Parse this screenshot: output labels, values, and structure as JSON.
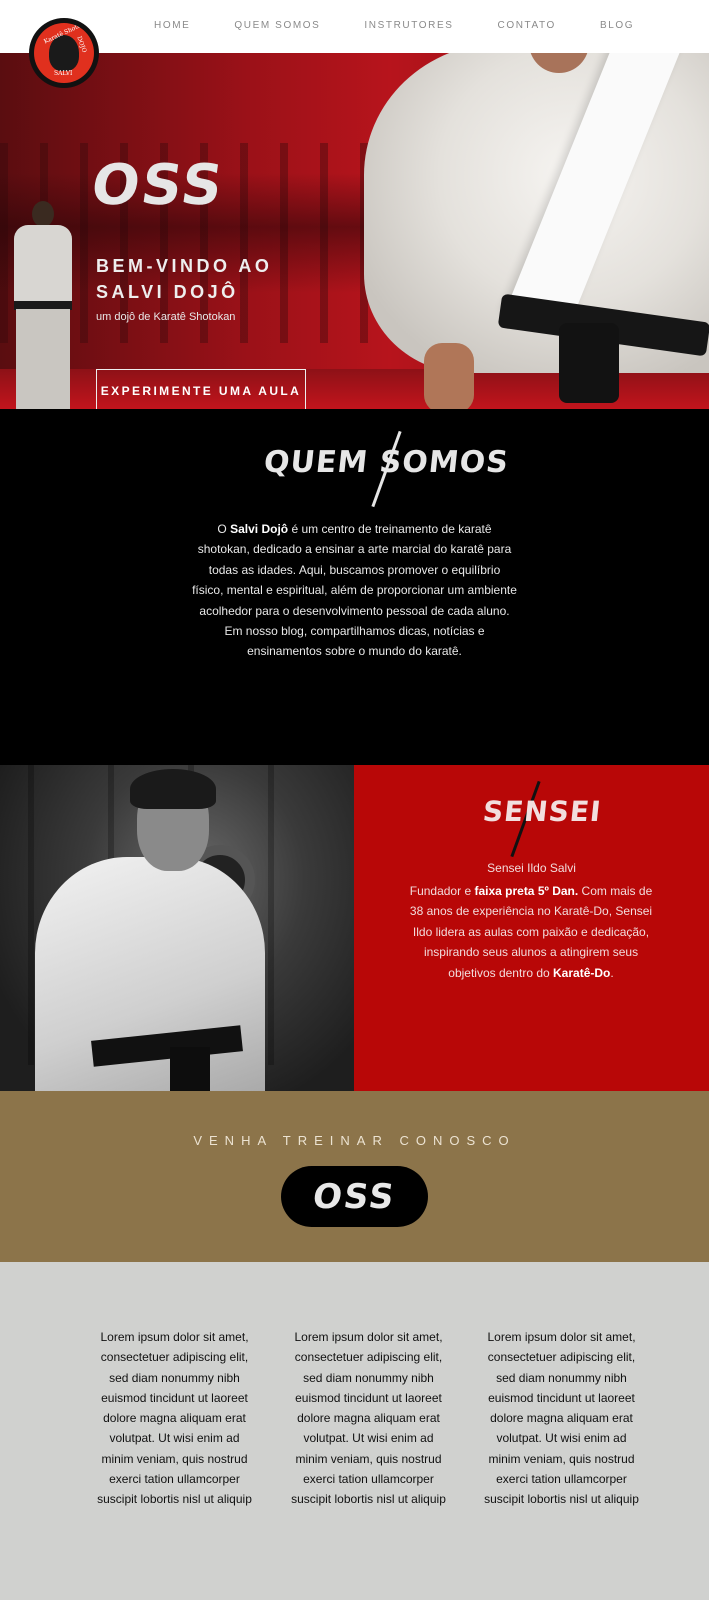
{
  "nav": {
    "logo": {
      "ring_text_top": "Karatê Shotokan",
      "ring_text_right": "DOJO",
      "ring_text_bottom": "SALVI"
    },
    "items": [
      {
        "label": "HOME"
      },
      {
        "label": "QUEM SOMOS"
      },
      {
        "label": "INSTRUTORES"
      },
      {
        "label": "CONTATO"
      },
      {
        "label": "BLOG"
      }
    ]
  },
  "hero": {
    "oss": "OSS",
    "title_line1": "BEM-VINDO AO",
    "title_line2": "SALVI DOJÔ",
    "subtitle": "um dojô de Karatê Shotokan",
    "cta_label": "EXPERIMENTE UMA AULA"
  },
  "about": {
    "heading": "QUEM SOMOS",
    "text_prefix": "O ",
    "text_bold": "Salvi Dojô",
    "text_rest": " é um centro de treinamento de karatê shotokan, dedicado a ensinar a arte marcial do karatê para todas as idades. Aqui, buscamos promover o equilíbrio físico, mental e espiritual, além de proporcionar um ambiente acolhedor para o desenvolvimento pessoal de cada aluno. Em nosso blog, compartilhamos dicas, notícias e ensinamentos sobre o mundo do karatê."
  },
  "sensei": {
    "heading": "SENSEI",
    "name": "Sensei Ildo Salvi",
    "text_a": "Fundador e ",
    "text_b": "faixa preta 5º Dan.",
    "text_c": " Com mais de 38 anos de experiência no Karatê-Do, Sensei Ildo lidera as aulas com paixão e dedicação, inspirando seus alunos a atingirem seus objetivos dentro do ",
    "text_d": "Karatê-Do",
    "text_e": "."
  },
  "join": {
    "text": "VENHA TREINAR CONOSCO",
    "button_label": "OSS"
  },
  "lorem": {
    "columns": [
      "Lorem ipsum dolor sit amet, consectetuer adipiscing elit, sed diam nonummy nibh euismod tincidunt ut laoreet dolore magna aliquam erat volutpat. Ut wisi enim ad minim veniam, quis nostrud exerci tation ullamcorper suscipit lobortis nisl ut aliquip",
      "Lorem ipsum dolor sit amet, consectetuer adipiscing elit, sed diam nonummy nibh euismod tincidunt ut laoreet dolore magna aliquam erat volutpat. Ut wisi enim ad minim veniam, quis nostrud exerci tation ullamcorper suscipit lobortis nisl ut aliquip",
      "Lorem ipsum dolor sit amet, consectetuer adipiscing elit, sed diam nonummy nibh euismod tincidunt ut laoreet dolore magna aliquam erat volutpat. Ut wisi enim ad minim veniam, quis nostrud exerci tation ullamcorper suscipit lobortis nisl ut aliquip"
    ]
  },
  "colors": {
    "hero_red": "#b7141c",
    "sensei_red": "#b80707",
    "gold": "#8c744a",
    "light_gray": "#d0d1cf"
  },
  "icons": {
    "logo": "tiger-logo-icon"
  }
}
